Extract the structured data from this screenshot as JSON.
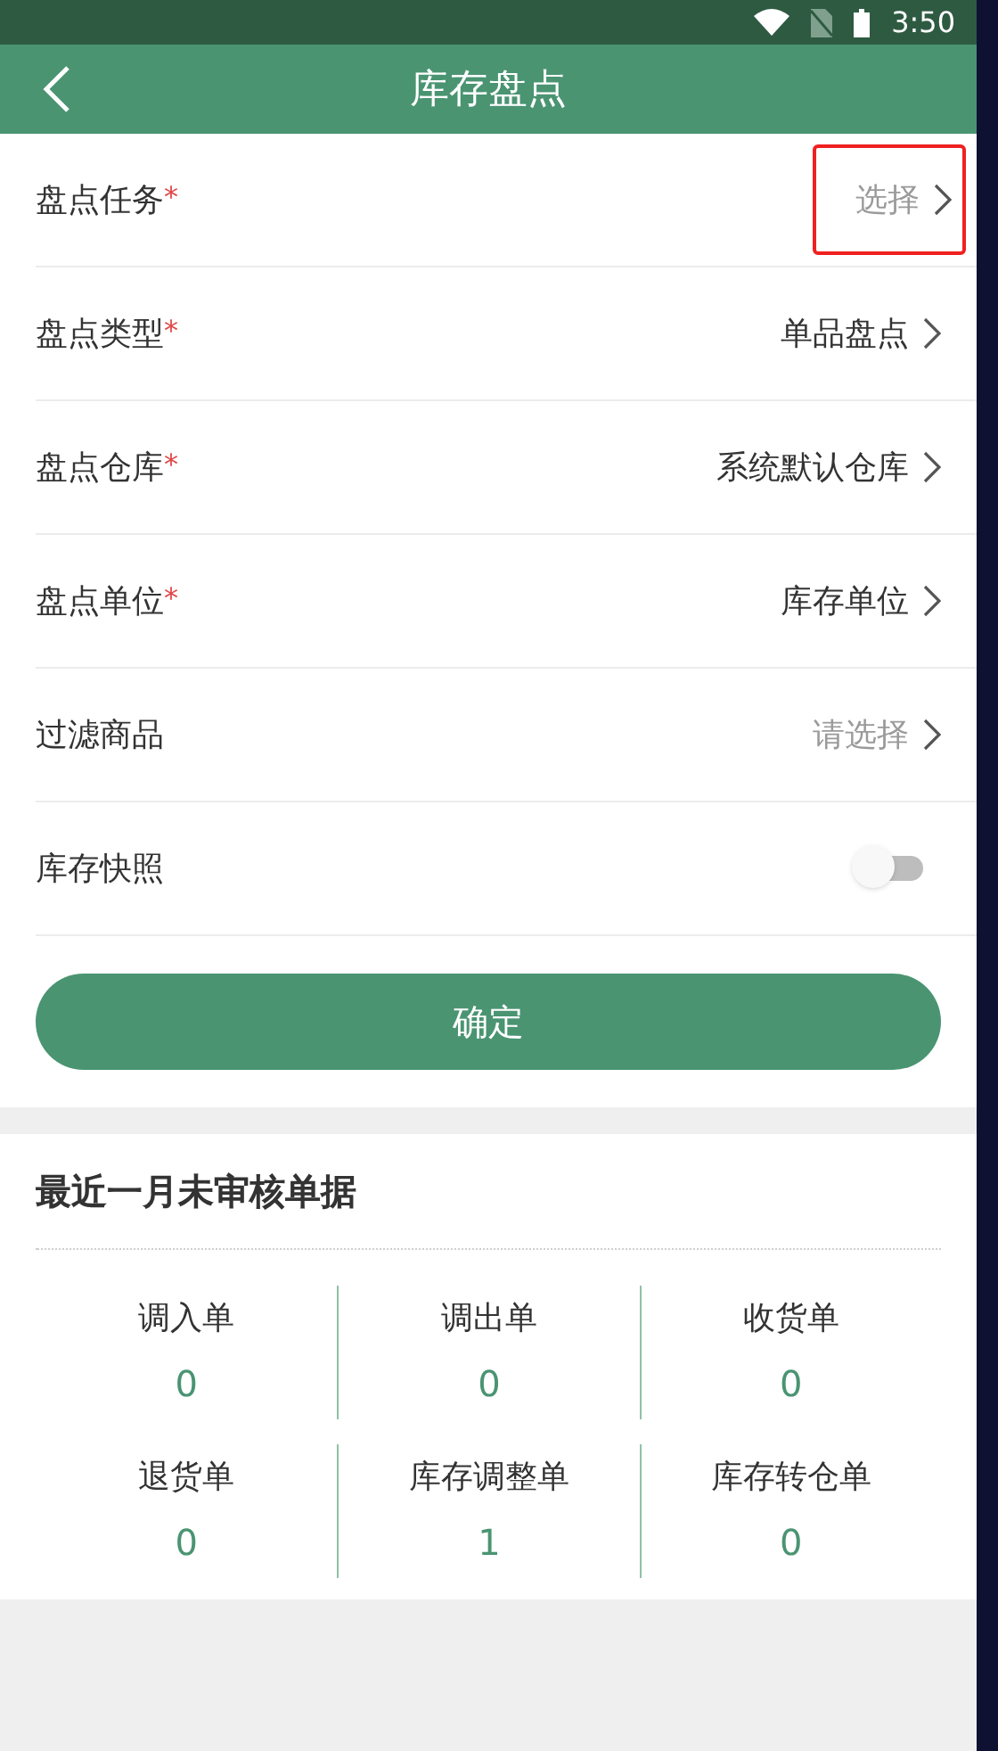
{
  "status_bar": {
    "time": "3:50"
  },
  "header": {
    "title": "库存盘点"
  },
  "form_rows": [
    {
      "kind": "select",
      "label": "盘点任务",
      "required_mark": "*",
      "placeholder": "选择",
      "highlighted": true
    },
    {
      "kind": "select",
      "label": "盘点类型",
      "required_mark": "*",
      "value": "单品盘点",
      "highlighted": false
    },
    {
      "kind": "select",
      "label": "盘点仓库",
      "required_mark": "*",
      "value": "系统默认仓库",
      "highlighted": false
    },
    {
      "kind": "select",
      "label": "盘点单位",
      "required_mark": "*",
      "value": "库存单位",
      "highlighted": false
    },
    {
      "kind": "select",
      "label": "过滤商品",
      "placeholder": "请选择",
      "highlighted": false
    },
    {
      "kind": "toggle",
      "label": "库存快照",
      "on": false
    }
  ],
  "confirm_button": "确定",
  "pending_section": {
    "title": "最近一月未审核单据",
    "items": [
      {
        "label": "调入单",
        "count": "0"
      },
      {
        "label": "调出单",
        "count": "0"
      },
      {
        "label": "收货单",
        "count": "0"
      },
      {
        "label": "退货单",
        "count": "0"
      },
      {
        "label": "库存调整单",
        "count": "1"
      },
      {
        "label": "库存转仓单",
        "count": "0"
      }
    ]
  }
}
